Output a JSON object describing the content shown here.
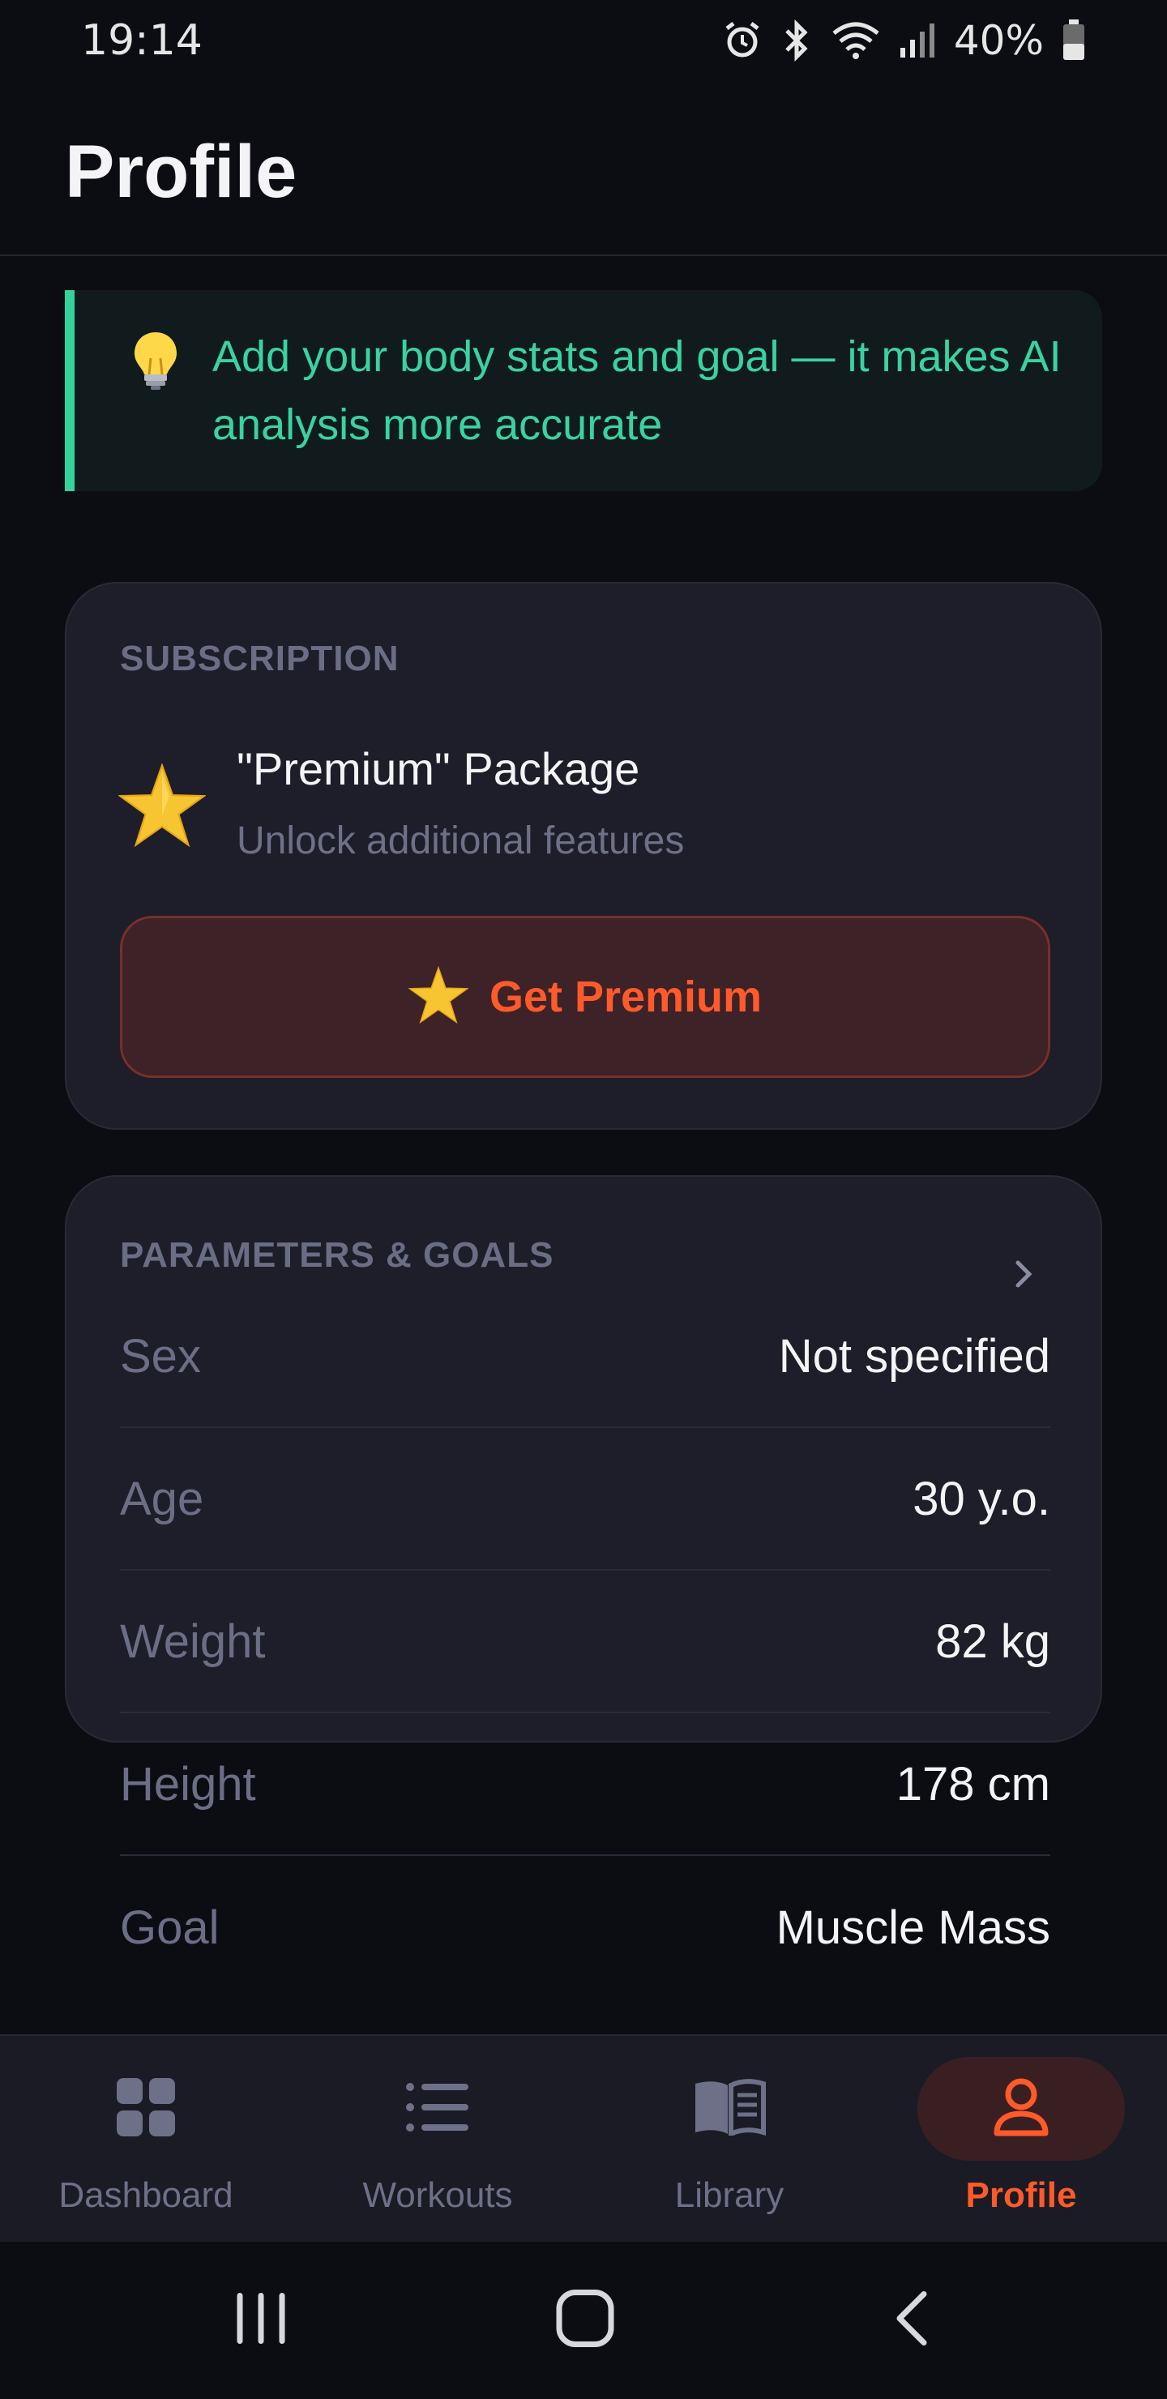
{
  "status_bar": {
    "time": "19:14",
    "battery": "40%",
    "icons": [
      "alarm-icon",
      "bluetooth-icon",
      "wifi-icon",
      "signal-icon",
      "battery-icon"
    ]
  },
  "header": {
    "title": "Profile"
  },
  "tip": {
    "icon": "lightbulb-icon",
    "text": "Add your body stats and goal — it makes AI analysis more accurate"
  },
  "subscription": {
    "section_label": "SUBSCRIPTION",
    "package_title": "\"Premium\" Package",
    "package_subtitle": "Unlock additional features",
    "button_label": "Get Premium"
  },
  "parameters": {
    "section_label": "PARAMETERS & GOALS",
    "rows": [
      {
        "label": "Sex",
        "value": "Not specified"
      },
      {
        "label": "Age",
        "value": "30 y.o."
      },
      {
        "label": "Weight",
        "value": "82 kg"
      },
      {
        "label": "Height",
        "value": "178 cm"
      },
      {
        "label": "Goal",
        "value": "Muscle Mass"
      }
    ]
  },
  "bottom_nav": {
    "items": [
      {
        "label": "Dashboard",
        "icon": "grid-icon",
        "active": false
      },
      {
        "label": "Workouts",
        "icon": "list-icon",
        "active": false
      },
      {
        "label": "Library",
        "icon": "book-icon",
        "active": false
      },
      {
        "label": "Profile",
        "icon": "user-icon",
        "active": true
      }
    ]
  },
  "colors": {
    "background": "#0c0d13",
    "card": "#1d1e29",
    "accent": "#ff5a2a",
    "tip": "#3ad3a0"
  }
}
